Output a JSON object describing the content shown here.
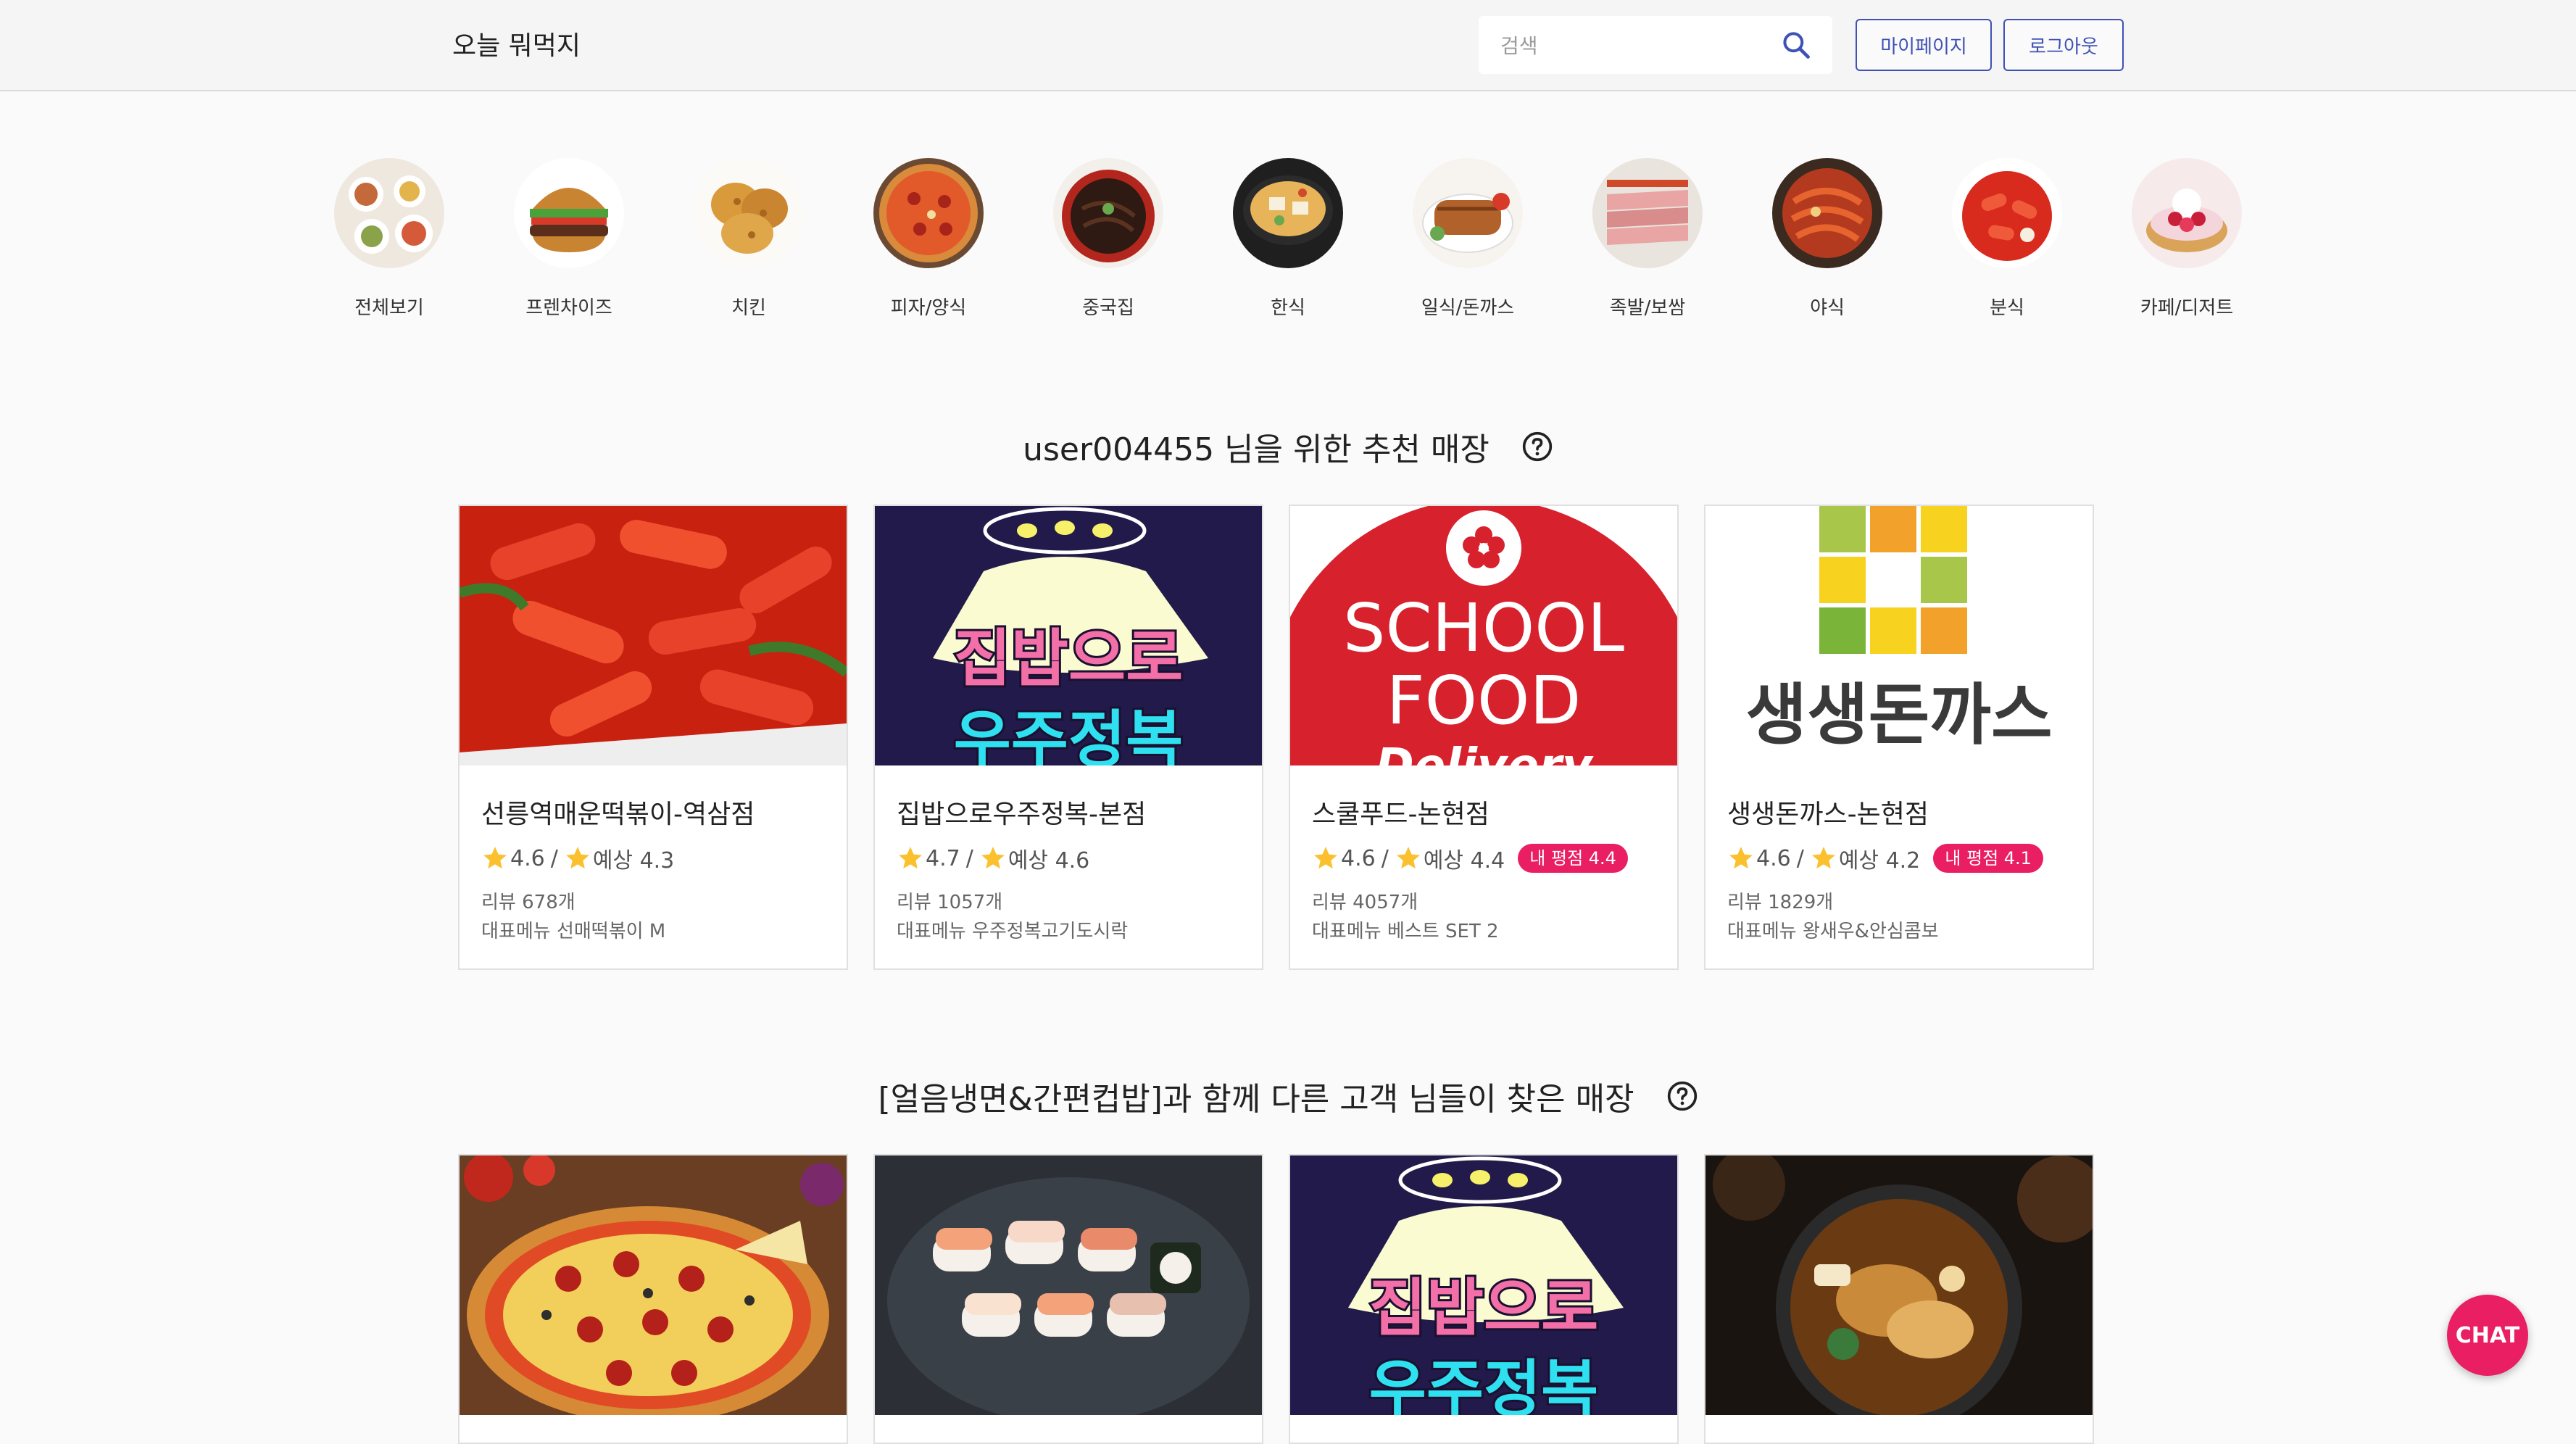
{
  "header": {
    "brand": "오늘 뭐먹지",
    "search_placeholder": "검색",
    "mypage_label": "마이페이지",
    "logout_label": "로그아웃"
  },
  "categories": [
    {
      "label": "전체보기",
      "icon": "food-platter-image"
    },
    {
      "label": "프렌차이즈",
      "icon": "burger-image"
    },
    {
      "label": "치킨",
      "icon": "fried-chicken-image"
    },
    {
      "label": "피자/양식",
      "icon": "pizza-image"
    },
    {
      "label": "중국집",
      "icon": "jajangmyeon-image"
    },
    {
      "label": "한식",
      "icon": "korean-stew-image"
    },
    {
      "label": "일식/돈까스",
      "icon": "tonkatsu-image"
    },
    {
      "label": "족발/보쌈",
      "icon": "jokbal-image"
    },
    {
      "label": "야식",
      "icon": "spicy-noodle-image"
    },
    {
      "label": "분식",
      "icon": "tteokbokki-image"
    },
    {
      "label": "카페/디저트",
      "icon": "tart-image"
    }
  ],
  "recommend": {
    "title": "user004455 님을 위한 추천 매장",
    "stores": [
      {
        "name": "선릉역매운떡볶이-역삼점",
        "rating": "4.6",
        "predict": "예상 4.3",
        "my_rating": "",
        "reviews": "리뷰 678개",
        "menu": "대표메뉴 선매떡볶이 M",
        "image": "tteokbokki-photo"
      },
      {
        "name": "집밥으로우주정복-본점",
        "rating": "4.7",
        "predict": "예상 4.6",
        "my_rating": "",
        "reviews": "리뷰 1057개",
        "menu": "대표메뉴 우주정복고기도시락",
        "image": "space-logo",
        "logo_text": "집밥으로",
        "logo_sub": "우주정복"
      },
      {
        "name": "스쿨푸드-논현점",
        "rating": "4.6",
        "predict": "예상 4.4",
        "my_rating": "내 평점 4.4",
        "reviews": "리뷰 4057개",
        "menu": "대표메뉴 베스트 SET 2",
        "image": "schoolfood-logo",
        "logo_line1": "SCHOOL",
        "logo_line2": "FOOD",
        "logo_line3": "Delivery"
      },
      {
        "name": "생생돈까스-논현점",
        "rating": "4.6",
        "predict": "예상 4.2",
        "my_rating": "내 평점 4.1",
        "reviews": "리뷰 1829개",
        "menu": "대표메뉴 왕새우&안심콤보",
        "image": "saengsaeng-logo",
        "logo_text": "생생돈까스"
      }
    ]
  },
  "also_found": {
    "title": "[얼음냉면&간편컵밥]과 함께 다른 고객 님들이 찾은 매장",
    "stores": [
      {
        "image": "pizza-photo"
      },
      {
        "image": "sushi-photo"
      },
      {
        "image": "space-logo",
        "logo_text": "집밥으로",
        "logo_sub": "우주정복"
      },
      {
        "image": "hotpot-photo"
      }
    ]
  },
  "chat_label": "CHAT",
  "colors": {
    "accent": "#3f51b5",
    "badge": "#e91e63",
    "star": "#fbc02d",
    "fab": "#e91e63"
  }
}
